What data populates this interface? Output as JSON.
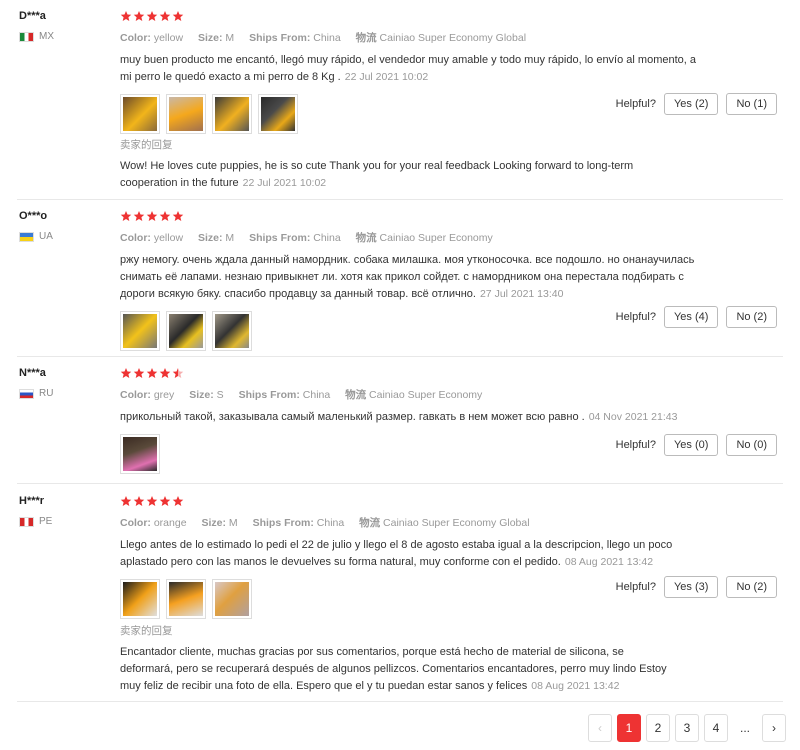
{
  "labels": {
    "color": "Color:",
    "size": "Size:",
    "ships_from": "Ships From:",
    "logistics": "物流",
    "helpful": "Helpful?",
    "seller_reply": "卖家的回复"
  },
  "colors": {
    "star": "#ee3333",
    "accent": "#ee3333"
  },
  "reviews": [
    {
      "user": "D***a",
      "country": "MX",
      "rating": 5,
      "color": "yellow",
      "size": "M",
      "ships_from": "China",
      "logistics": "Cainiao Super Economy Global",
      "text": "muy buen producto me encantó, llegó muy rápido, el vendedor muy amable y todo muy rápido, lo envío al momento, a mi perro le quedó exacto a mi perro de 8 Kg .",
      "date": "22 Jul 2021 10:02",
      "yes": "Yes (2)",
      "no": "No (1)",
      "reply": "Wow! He loves cute puppies, he is so cute Thank you for your real feedback Looking forward to long-term cooperation in the future",
      "reply_date": "22 Jul 2021 10:02"
    },
    {
      "user": "O***o",
      "country": "UA",
      "rating": 5,
      "color": "yellow",
      "size": "M",
      "ships_from": "China",
      "logistics": "Cainiao Super Economy",
      "text": "ржу немогу. очень ждала данный намордник. собака милашка. моя утконосочка. все подошло. но онанаучилась снимать её лапами. незнаю привыкнет ли. хотя как прикол сойдет. с намордником она перестала подбирать с дороги всякую бяку. спасибо продавцу за данный товар. всё отлично.",
      "date": "27 Jul 2021 13:40",
      "yes": "Yes (4)",
      "no": "No (2)"
    },
    {
      "user": "N***a",
      "country": "RU",
      "rating": 4.5,
      "color": "grey",
      "size": "S",
      "ships_from": "China",
      "logistics": "Cainiao Super Economy",
      "text": "прикольный такой, заказывала самый маленький размер. гавкать в нем может всю равно .",
      "date": "04 Nov 2021 21:43",
      "yes": "Yes (0)",
      "no": "No (0)"
    },
    {
      "user": "H***r",
      "country": "PE",
      "rating": 5,
      "color": "orange",
      "size": "M",
      "ships_from": "China",
      "logistics": "Cainiao Super Economy Global",
      "text": "Llego antes de lo estimado lo pedi el 22 de julio y llego el 8 de agosto estaba igual a la descripcion, llego un poco aplastado pero con las manos le devuelves su forma natural, muy conforme con el pedido.",
      "date": "08 Aug 2021 13:42",
      "yes": "Yes (3)",
      "no": "No (2)",
      "reply": "Encantador cliente, muchas gracias por sus comentarios, porque está hecho de material de silicona, se deformará, pero se recuperará después de algunos pellizcos. Comentarios encantadores, perro muy lindo Estoy muy feliz de recibir una foto de ella. Espero que el y tu puedan estar sanos y felices",
      "reply_date": "08 Aug 2021 13:42"
    }
  ],
  "pagination": {
    "prev": "‹",
    "pages": [
      "1",
      "2",
      "3",
      "4"
    ],
    "ellipsis": "...",
    "next": "›",
    "current": "1"
  }
}
